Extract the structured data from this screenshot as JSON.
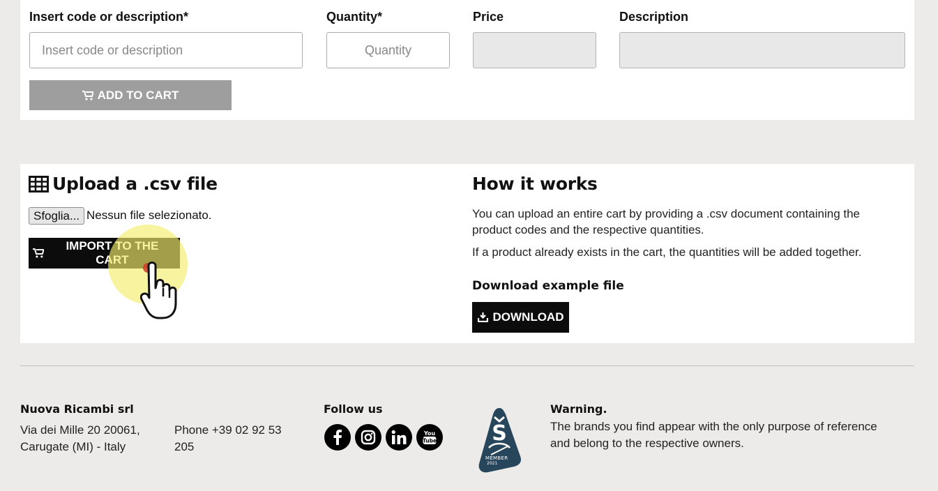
{
  "cart_form": {
    "code_label": "Insert code or description*",
    "code_placeholder": "Insert code or description",
    "quantity_label": "Quantity*",
    "quantity_placeholder": "Quantity",
    "price_label": "Price",
    "description_label": "Description",
    "add_button": "ADD TO CART"
  },
  "upload": {
    "title": "Upload a .csv file",
    "browse_button": "Sfoglia...",
    "file_status": "Nessun file selezionato.",
    "import_button": "IMPORT TO THE CART"
  },
  "how_it_works": {
    "title": "How it works",
    "paragraph1": "You can upload an entire cart by providing a .csv document containing the product codes and the respective quantities.",
    "paragraph2": "If a product already exists in the cart, the quantities will be added together.",
    "example_heading": "Download example file",
    "download_button": "DOWNLOAD"
  },
  "footer": {
    "company_name": "Nuova Ricambi srl",
    "address": "Via dei Mille 20 20061, Carugate (MI) - Italy",
    "phone": "Phone +39 02 92 53 205",
    "follow_heading": "Follow us",
    "badge_text": "MEMBER",
    "badge_year": "2021",
    "warning_heading": "Warning.",
    "warning_text": "The brands you find appear with the only purpose of reference and belong to the respective owners."
  },
  "icons": {
    "cart": "cart-icon",
    "table": "table-icon",
    "download": "download-icon",
    "pointer": "hand-pointer-icon",
    "social": [
      "facebook-icon",
      "instagram-icon",
      "linkedin-icon",
      "youtube-icon"
    ]
  },
  "colors": {
    "page_bg": "#ecebe9",
    "panel_bg": "#ffffff",
    "disabled_button": "#9e9e9e",
    "dark_button": "#0c0c0c",
    "highlight": "#f3ec6a",
    "click_dot": "#d23a2a"
  }
}
